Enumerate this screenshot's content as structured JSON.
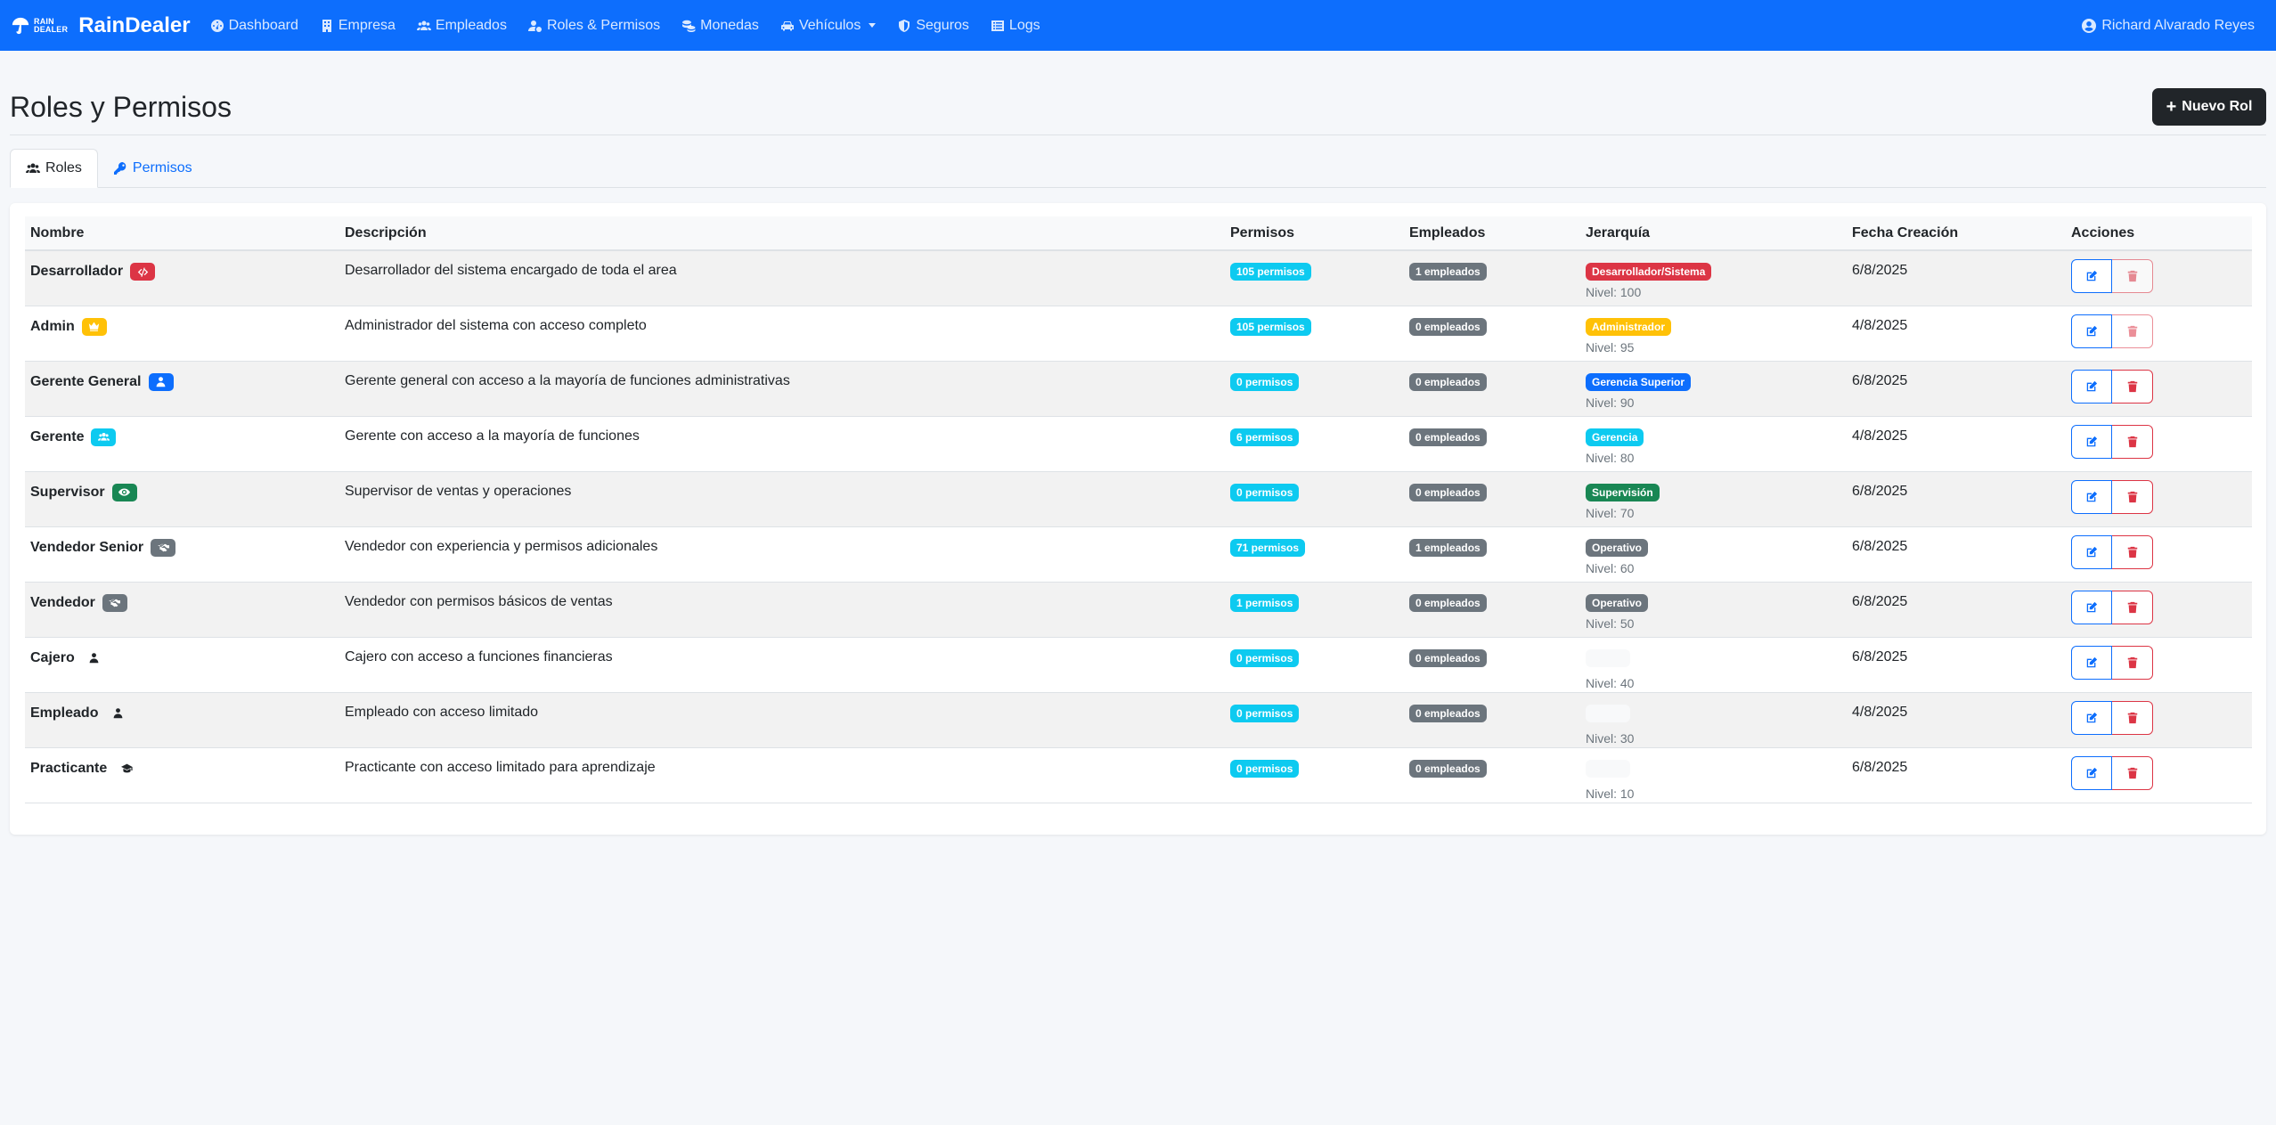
{
  "navbar": {
    "logo_top": "RAIN",
    "logo_bottom": "DEALER",
    "brand": "RainDealer",
    "items": [
      {
        "label": "Dashboard",
        "icon": "dashboard-icon"
      },
      {
        "label": "Empresa",
        "icon": "building-icon"
      },
      {
        "label": "Empleados",
        "icon": "users-icon"
      },
      {
        "label": "Roles & Permisos",
        "icon": "user-gear-icon"
      },
      {
        "label": "Monedas",
        "icon": "coins-icon"
      },
      {
        "label": "Vehículos",
        "icon": "car-icon"
      },
      {
        "label": "Seguros",
        "icon": "shield-icon"
      },
      {
        "label": "Logs",
        "icon": "list-icon"
      }
    ],
    "user": "Richard Alvarado Reyes"
  },
  "header": {
    "title": "Roles y Permisos",
    "new_button": "Nuevo Rol"
  },
  "tabs": [
    {
      "label": "Roles",
      "active": true
    },
    {
      "label": "Permisos",
      "active": false
    }
  ],
  "table": {
    "columns": [
      "Nombre",
      "Descripción",
      "Permisos",
      "Empleados",
      "Jerarquía",
      "Fecha Creación",
      "Acciones"
    ],
    "rows": [
      {
        "name": "Desarrollador",
        "icon": "code-icon",
        "icon_color": "#dc3545",
        "description": "Desarrollador del sistema encargado de toda el area",
        "permisos": "105 permisos",
        "empleados": "1 empleados",
        "hierarchy": "Desarrollador/Sistema",
        "hierarchy_color": "#dc3545",
        "level": "Nivel: 100",
        "date": "6/8/2025",
        "delete_disabled": true
      },
      {
        "name": "Admin",
        "icon": "crown-icon",
        "icon_color": "#ffc107",
        "description": "Administrador del sistema con acceso completo",
        "permisos": "105 permisos",
        "empleados": "0 empleados",
        "hierarchy": "Administrador",
        "hierarchy_color": "#ffc107",
        "level": "Nivel: 95",
        "date": "4/8/2025",
        "delete_disabled": true
      },
      {
        "name": "Gerente General",
        "icon": "user-tie-icon",
        "icon_color": "#0d6efd",
        "description": "Gerente general con acceso a la mayoría de funciones administrativas",
        "permisos": "0 permisos",
        "empleados": "0 empleados",
        "hierarchy": "Gerencia Superior",
        "hierarchy_color": "#0d6efd",
        "level": "Nivel: 90",
        "date": "6/8/2025",
        "delete_disabled": false
      },
      {
        "name": "Gerente",
        "icon": "users-icon",
        "icon_color": "#0dcaf0",
        "description": "Gerente con acceso a la mayoría de funciones",
        "permisos": "6 permisos",
        "empleados": "0 empleados",
        "hierarchy": "Gerencia",
        "hierarchy_color": "#0dcaf0",
        "level": "Nivel: 80",
        "date": "4/8/2025",
        "delete_disabled": false
      },
      {
        "name": "Supervisor",
        "icon": "eye-icon",
        "icon_color": "#198754",
        "description": "Supervisor de ventas y operaciones",
        "permisos": "0 permisos",
        "empleados": "0 empleados",
        "hierarchy": "Supervisión",
        "hierarchy_color": "#198754",
        "level": "Nivel: 70",
        "date": "6/8/2025",
        "delete_disabled": false
      },
      {
        "name": "Vendedor Senior",
        "icon": "handshake-icon",
        "icon_color": "#6c757d",
        "description": "Vendedor con experiencia y permisos adicionales",
        "permisos": "71 permisos",
        "empleados": "1 empleados",
        "hierarchy": "Operativo",
        "hierarchy_color": "#6c757d",
        "level": "Nivel: 60",
        "date": "6/8/2025",
        "delete_disabled": false
      },
      {
        "name": "Vendedor",
        "icon": "handshake-icon",
        "icon_color": "#6c757d",
        "description": "Vendedor con permisos básicos de ventas",
        "permisos": "1 permisos",
        "empleados": "0 empleados",
        "hierarchy": "Operativo",
        "hierarchy_color": "#6c757d",
        "level": "Nivel: 50",
        "date": "6/8/2025",
        "delete_disabled": false
      },
      {
        "name": "Cajero",
        "icon": "user-icon",
        "icon_color": "transparent",
        "description": "Cajero con acceso a funciones financieras",
        "permisos": "0 permisos",
        "empleados": "0 empleados",
        "hierarchy": "",
        "hierarchy_color": "#f8f9fa",
        "level": "Nivel: 40",
        "date": "6/8/2025",
        "delete_disabled": false
      },
      {
        "name": "Empleado",
        "icon": "user-icon",
        "icon_color": "transparent",
        "description": "Empleado con acceso limitado",
        "permisos": "0 permisos",
        "empleados": "0 empleados",
        "hierarchy": "",
        "hierarchy_color": "#f8f9fa",
        "level": "Nivel: 30",
        "date": "4/8/2025",
        "delete_disabled": false
      },
      {
        "name": "Practicante",
        "icon": "graduation-cap-icon",
        "icon_color": "transparent",
        "description": "Practicante con acceso limitado para aprendizaje",
        "permisos": "0 permisos",
        "empleados": "0 empleados",
        "hierarchy": "",
        "hierarchy_color": "#f8f9fa",
        "level": "Nivel: 10",
        "date": "6/8/2025",
        "delete_disabled": false
      }
    ]
  }
}
